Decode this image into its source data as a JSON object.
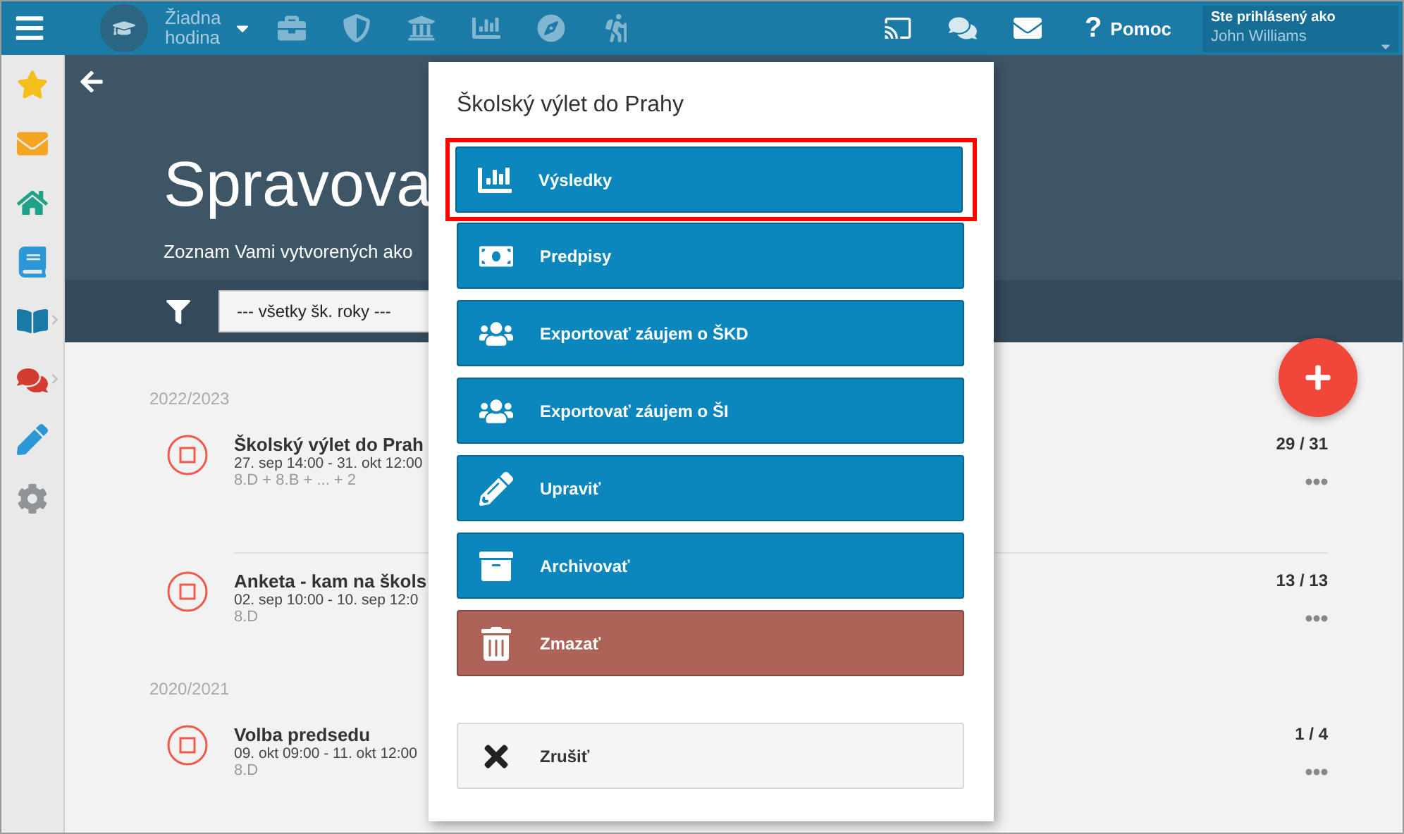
{
  "topbar": {
    "lesson": "Žiadna hodina",
    "help_mark": "?",
    "help": "Pomoc",
    "user_label": "Ste prihlásený ako",
    "user_name": "John Williams"
  },
  "sidebar": {
    "items": [
      {
        "has_submenu": false
      },
      {
        "has_submenu": false
      },
      {
        "has_submenu": false
      },
      {
        "has_submenu": false
      },
      {
        "has_submenu": true
      },
      {
        "has_submenu": true
      },
      {
        "has_submenu": false
      },
      {
        "has_submenu": false
      }
    ]
  },
  "header": {
    "title": "Spravova",
    "subtitle": "Zoznam Vami vytvorených ako",
    "filter": "--- všetky šk. roky ---"
  },
  "groups": [
    {
      "year": "2022/2023",
      "events": [
        {
          "title": "Školský výlet do Prah",
          "dates": "27. sep 14:00 - 31. okt 12:00",
          "classes": "8.D + 8.B + ... + 2",
          "count": "29 / 31"
        },
        {
          "title": "Anketa - kam na škols",
          "dates": "02. sep 10:00 - 10. sep 12:0",
          "classes": "8.D",
          "count": "13 / 13"
        }
      ]
    },
    {
      "year": "2020/2021",
      "events": [
        {
          "title": "Volba predsedu",
          "dates": "09. okt 09:00 - 11. okt 12:00",
          "classes": "8.D",
          "count": "1 / 4"
        }
      ]
    }
  ],
  "modal": {
    "title": "Školský výlet do Prahy",
    "actions": [
      {
        "kind": "results",
        "label": "Výsledky",
        "highlighted": true
      },
      {
        "kind": "fees",
        "label": "Predpisy",
        "highlighted": false
      },
      {
        "kind": "export",
        "label": "Exportovať záujem o ŠKD",
        "highlighted": false
      },
      {
        "kind": "export",
        "label": "Exportovať záujem o ŠI",
        "highlighted": false
      },
      {
        "kind": "edit",
        "label": "Upraviť",
        "highlighted": false
      },
      {
        "kind": "archive",
        "label": "Archivovať",
        "highlighted": false
      },
      {
        "kind": "delete",
        "label": "Zmazať",
        "highlighted": false
      },
      {
        "kind": "cancel",
        "label": "Zrušiť",
        "highlighted": false
      }
    ]
  }
}
